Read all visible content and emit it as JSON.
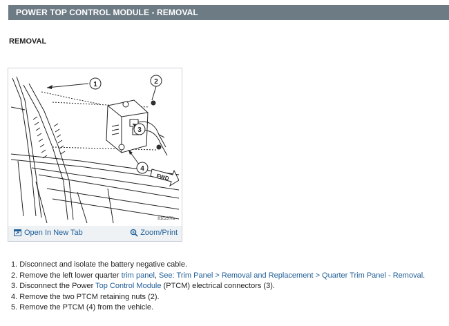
{
  "header": {
    "title": "POWER TOP CONTROL MODULE - REMOVAL"
  },
  "section": {
    "title": "REMOVAL"
  },
  "figure": {
    "callouts": [
      "1",
      "2",
      "3",
      "4"
    ],
    "fwd_label": "FWD",
    "figure_id": "81c257fa",
    "open_tab_label": "Open In New Tab",
    "zoom_label": "Zoom/Print",
    "open_tab_icon": "external-tab-icon",
    "zoom_icon": "magnifier-icon"
  },
  "steps": [
    {
      "num": "1.",
      "text": "Disconnect and isolate the battery negative cable."
    },
    {
      "num": "2.",
      "pre": "Remove the left lower quarter ",
      "link1": "trim panel",
      "mid": ", ",
      "link2": "See: Trim Panel > Removal and Replacement > Quarter Trim Panel - Removal",
      "post": "."
    },
    {
      "num": "3.",
      "pre": "Disconnect the Power ",
      "link1": "Top Control Module",
      "post": " (PTCM) electrical connectors (3)."
    },
    {
      "num": "4.",
      "text": "Remove the two PTCM retaining nuts (2)."
    },
    {
      "num": "5.",
      "text": "Remove the PTCM (4) from the vehicle."
    }
  ],
  "colors": {
    "header_bg": "#6d7b85",
    "link": "#1f5d96",
    "footer_bg": "#eef2f5"
  }
}
